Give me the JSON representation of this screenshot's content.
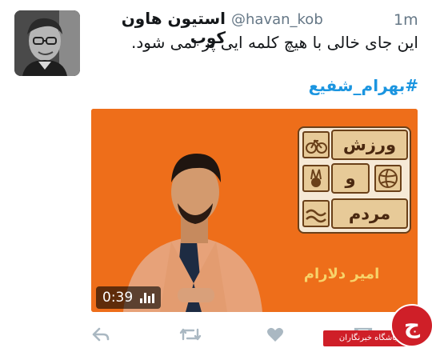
{
  "tweet": {
    "display_name": "استیون هاون کوب",
    "handle": "@havan_kob",
    "timestamp": "1m",
    "text": "این جای خالی با هیچ کلمه ایی پر نمی شود.",
    "hashtag": "#بهرام_شفیع"
  },
  "video": {
    "duration": "0:39",
    "logo": {
      "word_top": "ورزش",
      "connector": "و",
      "word_bottom": "مردم"
    },
    "caption": "امیر دلارام"
  },
  "actions": {
    "reply_icon": "reply-icon",
    "retweet_icon": "retweet-icon",
    "like_icon": "heart-icon",
    "dm_icon": "envelope-icon",
    "icon_color": "#aab8c2"
  },
  "watermark": {
    "label": "باشگاه خبرنگاران",
    "logo_letter": "ج"
  },
  "colors": {
    "link": "#1b95e0",
    "video_bg": "#ee6e1a",
    "watermark": "#cf1f28"
  }
}
